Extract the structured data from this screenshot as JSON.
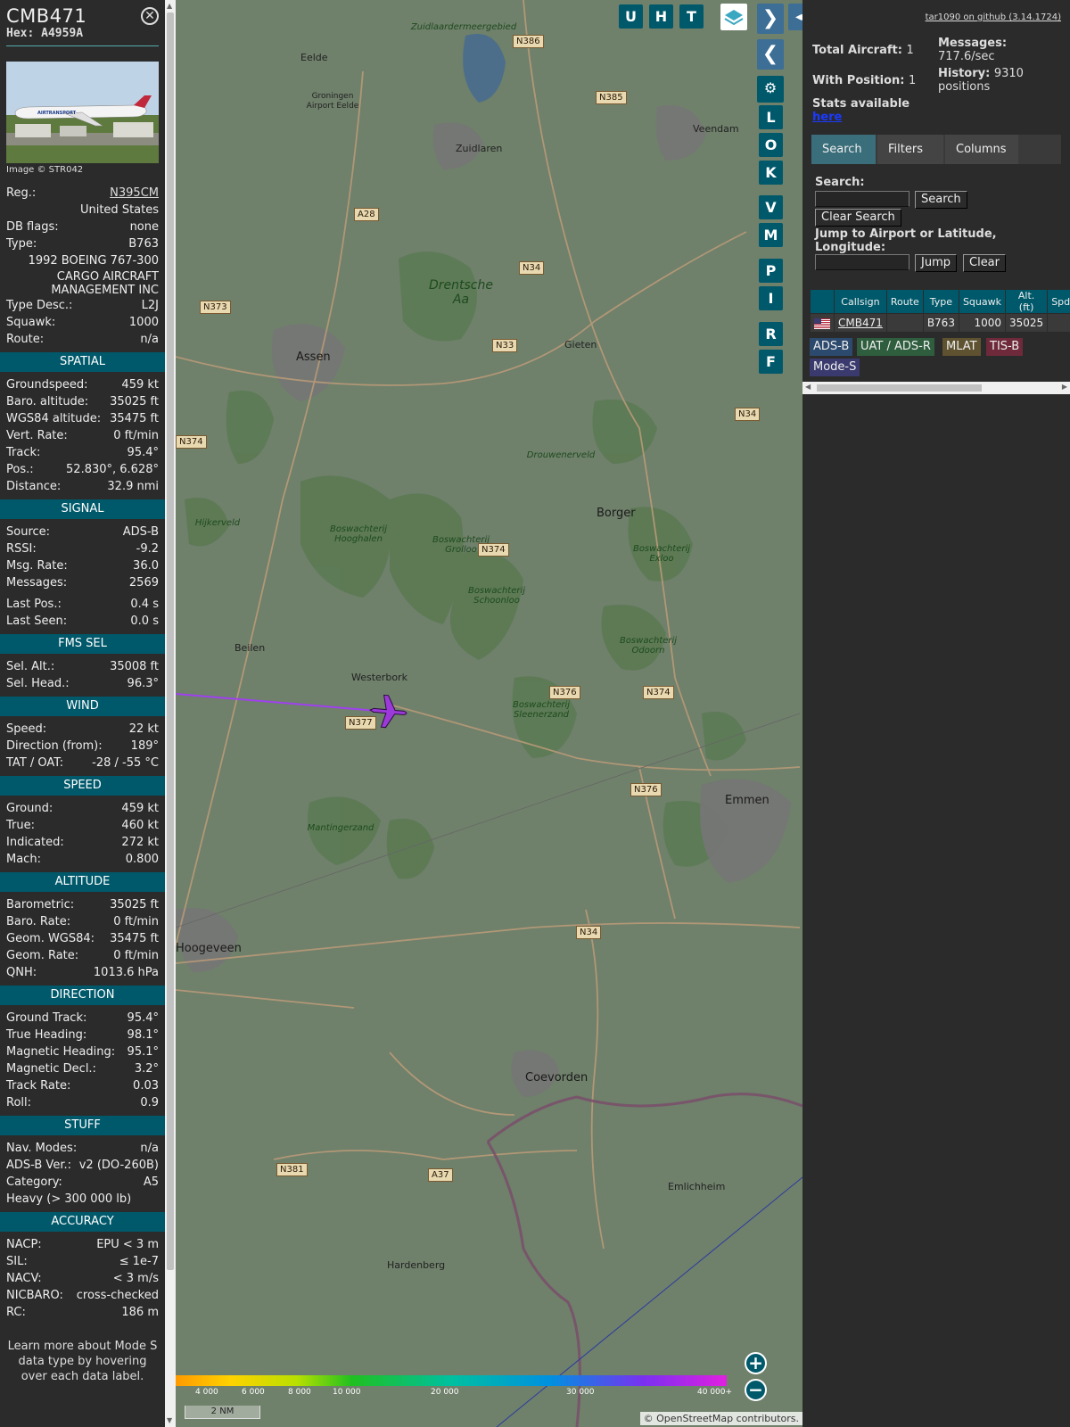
{
  "aircraft": {
    "callsign": "CMB471",
    "hex": "Hex: A4959A",
    "image_credit": "Image © STR042"
  },
  "details": [
    {
      "k": "Reg.:",
      "v": "N395CM",
      "link": true
    },
    {
      "k": "",
      "v": "United States"
    },
    {
      "k": "DB flags:",
      "v": "none"
    },
    {
      "k": "Type:",
      "v": "B763"
    },
    {
      "k": "",
      "v": "1992 BOEING 767-300"
    },
    {
      "k": "",
      "v": "CARGO AIRCRAFT MANAGEMENT INC",
      "tall": true
    },
    {
      "k": "Type Desc.:",
      "v": "L2J"
    },
    {
      "k": "Squawk:",
      "v": "1000"
    },
    {
      "k": "Route:",
      "v": "n/a"
    }
  ],
  "sections": [
    {
      "title": "SPATIAL",
      "rows": [
        {
          "k": "Groundspeed:",
          "v": "459 kt"
        },
        {
          "k": "Baro. altitude:",
          "v": "35025 ft"
        },
        {
          "k": "WGS84 altitude:",
          "v": "35475 ft"
        },
        {
          "k": "Vert. Rate:",
          "v": "0 ft/min"
        },
        {
          "k": "Track:",
          "v": "95.4°"
        },
        {
          "k": "Pos.:",
          "v": "52.830°, 6.628°"
        },
        {
          "k": "Distance:",
          "v": "32.9 nmi"
        }
      ]
    },
    {
      "title": "SIGNAL",
      "rows": [
        {
          "k": "Source:",
          "v": "ADS-B"
        },
        {
          "k": "RSSI:",
          "v": "-9.2"
        },
        {
          "k": "Msg. Rate:",
          "v": "36.0"
        },
        {
          "k": "Messages:",
          "v": "2569"
        },
        {
          "gap": true
        },
        {
          "k": "Last Pos.:",
          "v": "0.4 s"
        },
        {
          "k": "Last Seen:",
          "v": "0.0 s"
        }
      ]
    },
    {
      "title": "FMS SEL",
      "rows": [
        {
          "k": "Sel. Alt.:",
          "v": "35008 ft"
        },
        {
          "k": "Sel. Head.:",
          "v": "96.3°"
        }
      ]
    },
    {
      "title": "WIND",
      "rows": [
        {
          "k": "Speed:",
          "v": "22 kt"
        },
        {
          "k": "Direction (from):",
          "v": "189°"
        },
        {
          "k": "TAT / OAT:",
          "v": "-28 / -55 °C"
        }
      ]
    },
    {
      "title": "SPEED",
      "rows": [
        {
          "k": "Ground:",
          "v": "459 kt"
        },
        {
          "k": "True:",
          "v": "460 kt"
        },
        {
          "k": "Indicated:",
          "v": "272 kt"
        },
        {
          "k": "Mach:",
          "v": "0.800"
        }
      ]
    },
    {
      "title": "ALTITUDE",
      "rows": [
        {
          "k": "Barometric:",
          "v": "35025 ft"
        },
        {
          "k": "Baro. Rate:",
          "v": "0 ft/min"
        },
        {
          "k": "Geom. WGS84:",
          "v": "35475 ft"
        },
        {
          "k": "Geom. Rate:",
          "v": "0 ft/min"
        },
        {
          "k": "QNH:",
          "v": "1013.6 hPa"
        }
      ]
    },
    {
      "title": "DIRECTION",
      "rows": [
        {
          "k": "Ground Track:",
          "v": "95.4°"
        },
        {
          "k": "True Heading:",
          "v": "98.1°"
        },
        {
          "k": "Magnetic Heading:",
          "v": "95.1°"
        },
        {
          "k": "Magnetic Decl.:",
          "v": "3.2°"
        },
        {
          "k": "Track Rate:",
          "v": "0.03"
        },
        {
          "k": "Roll:",
          "v": "0.9"
        }
      ]
    },
    {
      "title": "STUFF",
      "rows": [
        {
          "k": "Nav. Modes:",
          "v": "n/a"
        },
        {
          "k": "ADS-B Ver.:",
          "v": "v2 (DO-260B)"
        },
        {
          "k": "Category:",
          "v": "A5"
        },
        {
          "k": "Heavy (> 300 000 lb)",
          "v": ""
        }
      ]
    },
    {
      "title": "ACCURACY",
      "rows": [
        {
          "k": "NACP:",
          "v": "EPU < 3 m"
        },
        {
          "k": "SIL:",
          "v": "≤ 1e-7"
        },
        {
          "k": "NACV:",
          "v": "< 3 m/s"
        },
        {
          "k": "NICBARO:",
          "v": "cross-checked"
        },
        {
          "k": "RC:",
          "v": "186 m"
        }
      ]
    }
  ],
  "learn_more": "Learn more about Mode S data type by hovering over each data label.",
  "map": {
    "top_buttons": [
      "U",
      "H",
      "T"
    ],
    "side_buttons": [
      "L",
      "O",
      "K",
      "V",
      "M",
      "P",
      "I",
      "R",
      "F"
    ],
    "cities": [
      {
        "name": "Assen"
      },
      {
        "name": "Emmen"
      },
      {
        "name": "Hoogeveen"
      },
      {
        "name": "Borger"
      },
      {
        "name": "Coevorden"
      },
      {
        "name": "Zuidlaren"
      },
      {
        "name": "Veendam"
      },
      {
        "name": "Gieten"
      },
      {
        "name": "Westerbork"
      },
      {
        "name": "Beilen"
      },
      {
        "name": "Eelde"
      },
      {
        "name": "Hardenberg"
      },
      {
        "name": "Emlichheim"
      },
      {
        "name": "Groningen Airport Eelde"
      }
    ],
    "forests": [
      "Drentsche Aa",
      "Drouwenerveld",
      "Boswachterij Hooghalen",
      "Boswachterij Grolloo",
      "Boswachterij Schoonloo",
      "Boswachterij Exloo",
      "Boswachterij Odoorn",
      "Boswachterij Sleenerzand",
      "Mantingerzand",
      "Hijkerveld",
      "Zuidlaardermeergebied"
    ],
    "roads": [
      "N386",
      "N385",
      "A28",
      "N34",
      "N373",
      "N33",
      "N374",
      "N376",
      "N374",
      "N376",
      "N34",
      "N381",
      "A37",
      "N377",
      "N34",
      "N374"
    ],
    "altitude_labels": [
      "4 000",
      "6 000",
      "8 000",
      "10 000",
      "20 000",
      "30 000",
      "40 000+"
    ],
    "scale": "2 NM",
    "attribution": "© OpenStreetMap contributors."
  },
  "panel": {
    "github": "tar1090 on github (3.14.1724)",
    "total_label": "Total Aircraft:",
    "total_value": "1",
    "withpos_label": "With Position:",
    "withpos_value": "1",
    "messages_label": "Messages:",
    "messages_value": "717.6/sec",
    "history_label": "History:",
    "history_value": "9310 positions",
    "stats_label": "Stats available",
    "stats_link": "here",
    "tabs": [
      "Search",
      "Filters",
      "Columns"
    ],
    "search_label": "Search:",
    "search_button": "Search",
    "clear_search_button": "Clear Search",
    "jump_label": "Jump to Airport or Latitude, Longitude:",
    "jump_button": "Jump",
    "clear_button": "Clear",
    "columns": [
      "Callsign",
      "Route",
      "Type",
      "Squawk",
      "Alt. (ft)",
      "Spd."
    ],
    "rows": [
      {
        "callsign": "CMB471",
        "route": "",
        "type": "B763",
        "squawk": "1000",
        "alt": "35025",
        "spd": ""
      }
    ],
    "badges": [
      {
        "label": "ADS-B",
        "color": "#2c4a6e"
      },
      {
        "label": "UAT / ADS-R",
        "color": "#2e5e3e"
      },
      {
        "label": "MLAT",
        "color": "#5e5230"
      },
      {
        "label": "TIS-B",
        "color": "#6e2a3a"
      },
      {
        "label": "Mode-S",
        "color": "#3a3a6e"
      }
    ]
  }
}
